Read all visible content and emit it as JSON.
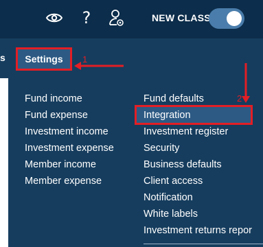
{
  "header": {
    "new_class_label": "NEW CLASS",
    "toggle_on": true,
    "icons": [
      "eye-icon",
      "help-icon",
      "user-settings-icon"
    ],
    "help_glyph": "?"
  },
  "nav": {
    "partial_label": "s",
    "settings_label": "Settings"
  },
  "annotations": {
    "step1": "1",
    "step2": "2"
  },
  "menu": {
    "left": [
      "Fund income",
      "Fund expense",
      "Investment income",
      "Investment expense",
      "Member income",
      "Member expense"
    ],
    "right": [
      "Fund defaults",
      "Integration",
      "Investment register",
      "Security",
      "Business defaults",
      "Client access",
      "Notification",
      "White labels",
      "Investment returns repor"
    ]
  },
  "colors": {
    "topbar": "#0c2d4b",
    "navbar": "#163d5e",
    "highlight": "#2d5a84",
    "annotation": "#e31e24",
    "toggle": "#4a7dab"
  }
}
